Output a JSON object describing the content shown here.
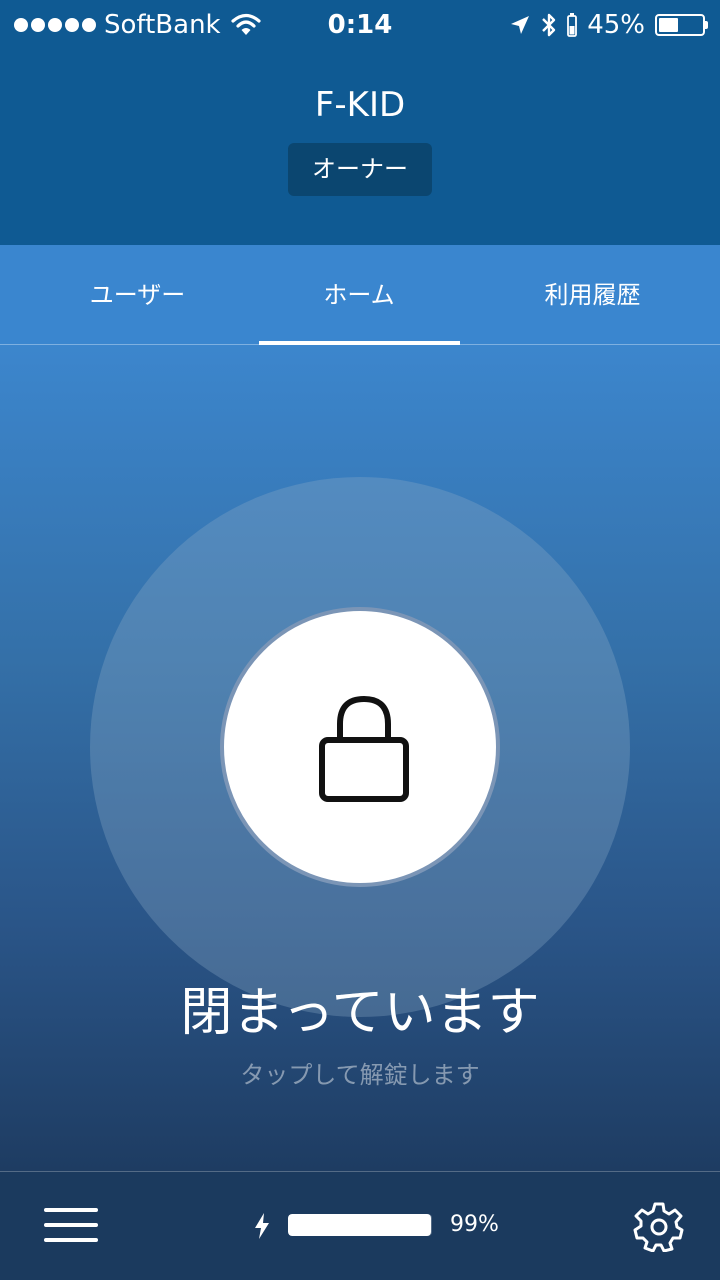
{
  "status_bar": {
    "carrier": "SoftBank",
    "time": "0:14",
    "battery_percent_label": "45%",
    "battery_level": 0.45,
    "signal_bars": 5
  },
  "header": {
    "lock_name": "F-KID",
    "role": "オーナー"
  },
  "tabs": [
    {
      "label": "ユーザー",
      "active": false
    },
    {
      "label": "ホーム",
      "active": true
    },
    {
      "label": "利用履歴",
      "active": false
    }
  ],
  "lock": {
    "status": "閉まっています",
    "hint": "タップして解錠します",
    "icon": "padlock-closed-icon"
  },
  "bottom_bar": {
    "menu_icon": "hamburger-menu-icon",
    "device_battery_percent_label": "99%",
    "device_battery_level": 0.99,
    "settings_icon": "gear-icon"
  },
  "colors": {
    "header_bg": "#0f5a93",
    "tab_bg": "#3a86cf",
    "main_gradient_top": "#3c86cd",
    "main_gradient_bottom": "#1e3c62",
    "bottom_bg": "#1b3a5e"
  }
}
